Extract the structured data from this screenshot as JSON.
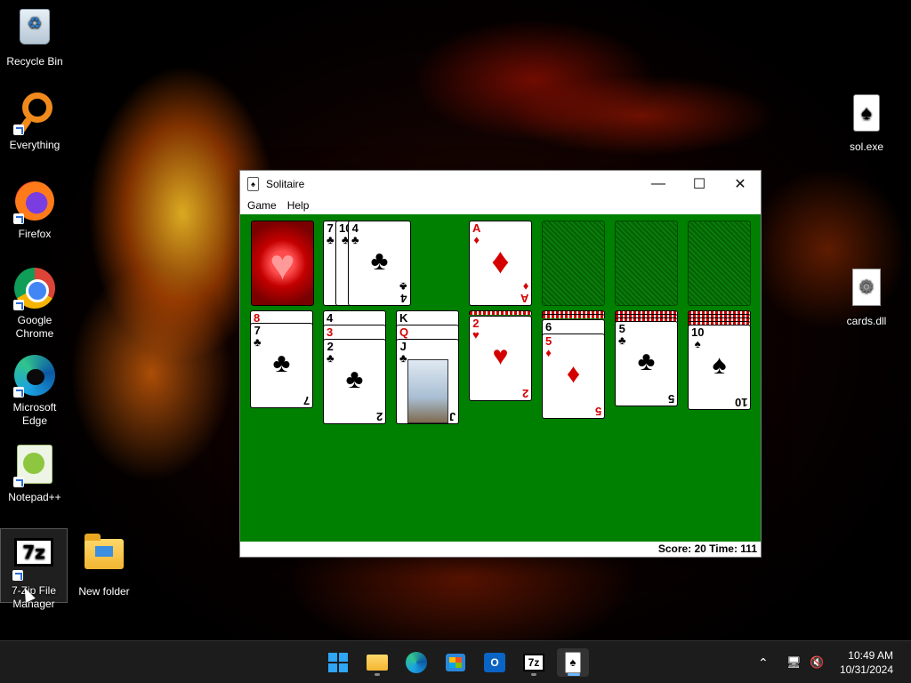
{
  "desktop": {
    "left_icons": [
      {
        "label": "Recycle Bin",
        "icon": "recycle-bin-icon"
      },
      {
        "label": "Everything",
        "icon": "everything-search-icon"
      },
      {
        "label": "Firefox",
        "icon": "firefox-icon"
      },
      {
        "label": "Google Chrome",
        "icon": "chrome-icon"
      },
      {
        "label": "Microsoft Edge",
        "icon": "edge-icon"
      },
      {
        "label": "Notepad++",
        "icon": "notepadpp-icon"
      },
      {
        "label": "7-Zip File Manager",
        "icon": "7zip-icon",
        "glyph": "7z"
      },
      {
        "label": "New folder",
        "icon": "folder-icon"
      }
    ],
    "right_icons": [
      {
        "label": "sol.exe",
        "icon": "solitaire-exe-icon",
        "glyph": "♠"
      },
      {
        "label": "cards.dll",
        "icon": "dll-file-icon",
        "glyph": "⚙"
      }
    ]
  },
  "window": {
    "title": "Solitaire",
    "app_icon_glyph": "♠",
    "controls": {
      "minimize": "—",
      "maximize": "☐",
      "close": "✕"
    },
    "menu": [
      "Game",
      "Help"
    ],
    "status": "Score: 20 Time: 111",
    "colors": {
      "felt": "#008000",
      "red_suit": "#d40000"
    }
  },
  "game": {
    "deck": "heart card back",
    "waste": [
      {
        "rank": "7",
        "suit": "♣"
      },
      {
        "rank": "10",
        "suit": "♣"
      },
      {
        "rank": "4",
        "suit": "♣",
        "top": true
      }
    ],
    "foundations": [
      {
        "rank": "A",
        "suit": "♦"
      },
      {
        "empty": true
      },
      {
        "empty": true
      },
      {
        "empty": true
      }
    ],
    "tableau": [
      {
        "hidden": 0,
        "cards": [
          {
            "rank": "8",
            "suit": "♥"
          },
          {
            "rank": "7",
            "suit": "♣"
          }
        ]
      },
      {
        "hidden": 0,
        "cards": [
          {
            "rank": "4",
            "suit": "♠"
          },
          {
            "rank": "3",
            "suit": "♥"
          },
          {
            "rank": "2",
            "suit": "♣"
          }
        ]
      },
      {
        "hidden": 0,
        "cards": [
          {
            "rank": "K",
            "suit": "♦"
          },
          {
            "rank": "Q",
            "suit": "♥"
          },
          {
            "rank": "J",
            "suit": "♣"
          }
        ]
      },
      {
        "hidden": 1,
        "cards": [
          {
            "rank": "2",
            "suit": "♥"
          }
        ]
      },
      {
        "hidden": 2,
        "cards": [
          {
            "rank": "6",
            "suit": "♠"
          },
          {
            "rank": "5",
            "suit": "♦"
          }
        ]
      },
      {
        "hidden": 3,
        "cards": [
          {
            "rank": "5",
            "suit": "♣"
          }
        ]
      },
      {
        "hidden": 4,
        "cards": [
          {
            "rank": "10",
            "suit": "♠"
          }
        ]
      }
    ]
  },
  "taskbar": {
    "apps": [
      {
        "name": "start",
        "icon": "windows-start-icon"
      },
      {
        "name": "file-explorer",
        "icon": "file-explorer-icon"
      },
      {
        "name": "edge",
        "icon": "edge-icon"
      },
      {
        "name": "store",
        "icon": "microsoft-store-icon"
      },
      {
        "name": "outlook",
        "icon": "outlook-icon",
        "glyph": "O"
      },
      {
        "name": "7zip",
        "icon": "7zip-icon",
        "glyph": "7z"
      },
      {
        "name": "solitaire",
        "icon": "solitaire-icon",
        "glyph": "♠"
      }
    ],
    "tray": {
      "chevron": "⌃",
      "network": "🖥",
      "volume": "🔇"
    },
    "time": "10:49 AM",
    "date": "10/31/2024"
  }
}
